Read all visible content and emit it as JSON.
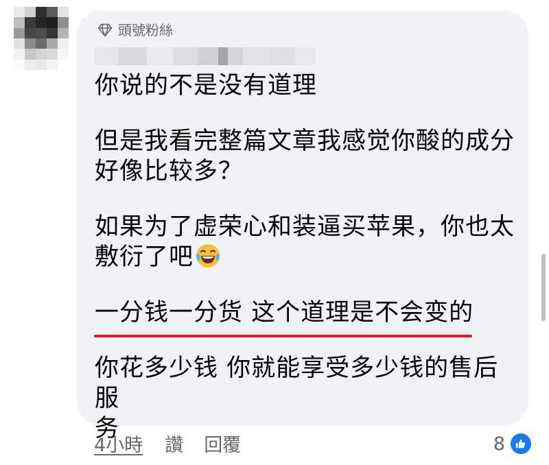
{
  "comment": {
    "badge_label": "頭號粉絲",
    "badge_icon": "diamond-icon",
    "paragraphs": [
      {
        "text": "你说的不是没有道理"
      },
      {
        "text": "但是我看完整篇文章我感觉你酸的成分\n好像比较多？"
      },
      {
        "text": "如果为了虚荣心和装逼买苹果，你也太\n敷衍了吧",
        "emoji": "laughing-crying-emoji"
      },
      {
        "text": "一分钱一分货 这个道理是不会变的",
        "underline_color": "#e2182c"
      },
      {
        "text": "你花多少钱 你就能享受多少钱的售后服\n务"
      }
    ]
  },
  "actions": {
    "time": "4小時",
    "like": "讚",
    "reply": "回覆"
  },
  "reactions": {
    "count": "8",
    "icon": "thumbs-up-icon",
    "color": "#1877f2"
  },
  "colors": {
    "bubble": "#f0f2f5",
    "secondary_text": "#65676b",
    "underline": "#e2182c"
  }
}
